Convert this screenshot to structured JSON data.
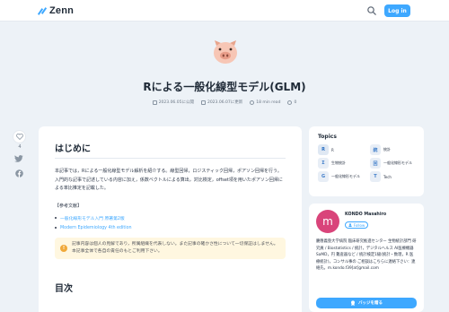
{
  "header": {
    "brand": "Zenn",
    "login_label": "Log in"
  },
  "article": {
    "title": "Rによる一般化線型モデル(GLM)",
    "published": "2023.06.05に公開",
    "updated": "2023.06.07に更新",
    "read_time": "18 min read",
    "comments": "0",
    "likes": "4",
    "intro_heading": "はじめに",
    "intro_paragraph": "本記事では，Rによる一般化線型モデル解析を紹介する。線型回帰，ロジスティック回帰，ポアソン回帰を行う。入門的な記事で記述している内容に加え，係数ベクトルによる算出，対比検定，offset項を用いたポアソン回帰による率比推定を記載した。",
    "refs_label": "【参考文献】",
    "references": [
      "一般化線形モデル入門 原著第2版",
      "Modern Epidemiology 4th edition"
    ],
    "notice": "記事内容は個人の見解であり，所属組織を代表しない。また記事の確かさ性について一切保証はしません。本記事全体で各自の責任のもとご利用下さい。",
    "toc_heading": "目次"
  },
  "topics": {
    "title": "Topics",
    "items": [
      {
        "icon": "R",
        "label": "R"
      },
      {
        "icon": "統",
        "label": "統計"
      },
      {
        "icon": "Σ",
        "label": "生物統計"
      },
      {
        "icon": "回",
        "label": "一般化線形モデル"
      },
      {
        "icon": "G",
        "label": "一般化線形モデル"
      },
      {
        "icon": "T",
        "label": "Tech"
      }
    ]
  },
  "author": {
    "initial": "m",
    "name": "KONDO Masahiro",
    "follow_label": "Follow",
    "bio": "慶應義塾大学病院 臨床研究推進センター 生物統計部門 研究員 / Biostatistics / 統計，デジタルヘルス AI医療機器 SaMD，円 難産器など / 統計検定1級(統計・数理，R 医療統計)，コンサル事の ご相談はこちらに連絡下さい：連絡先。m.kondo.f39[at]gmail.com",
    "badge_label": "バッジを贈る"
  },
  "colors": {
    "accent": "#3ea8ff",
    "background": "#edf2f7",
    "avatar": "#d9447a"
  }
}
